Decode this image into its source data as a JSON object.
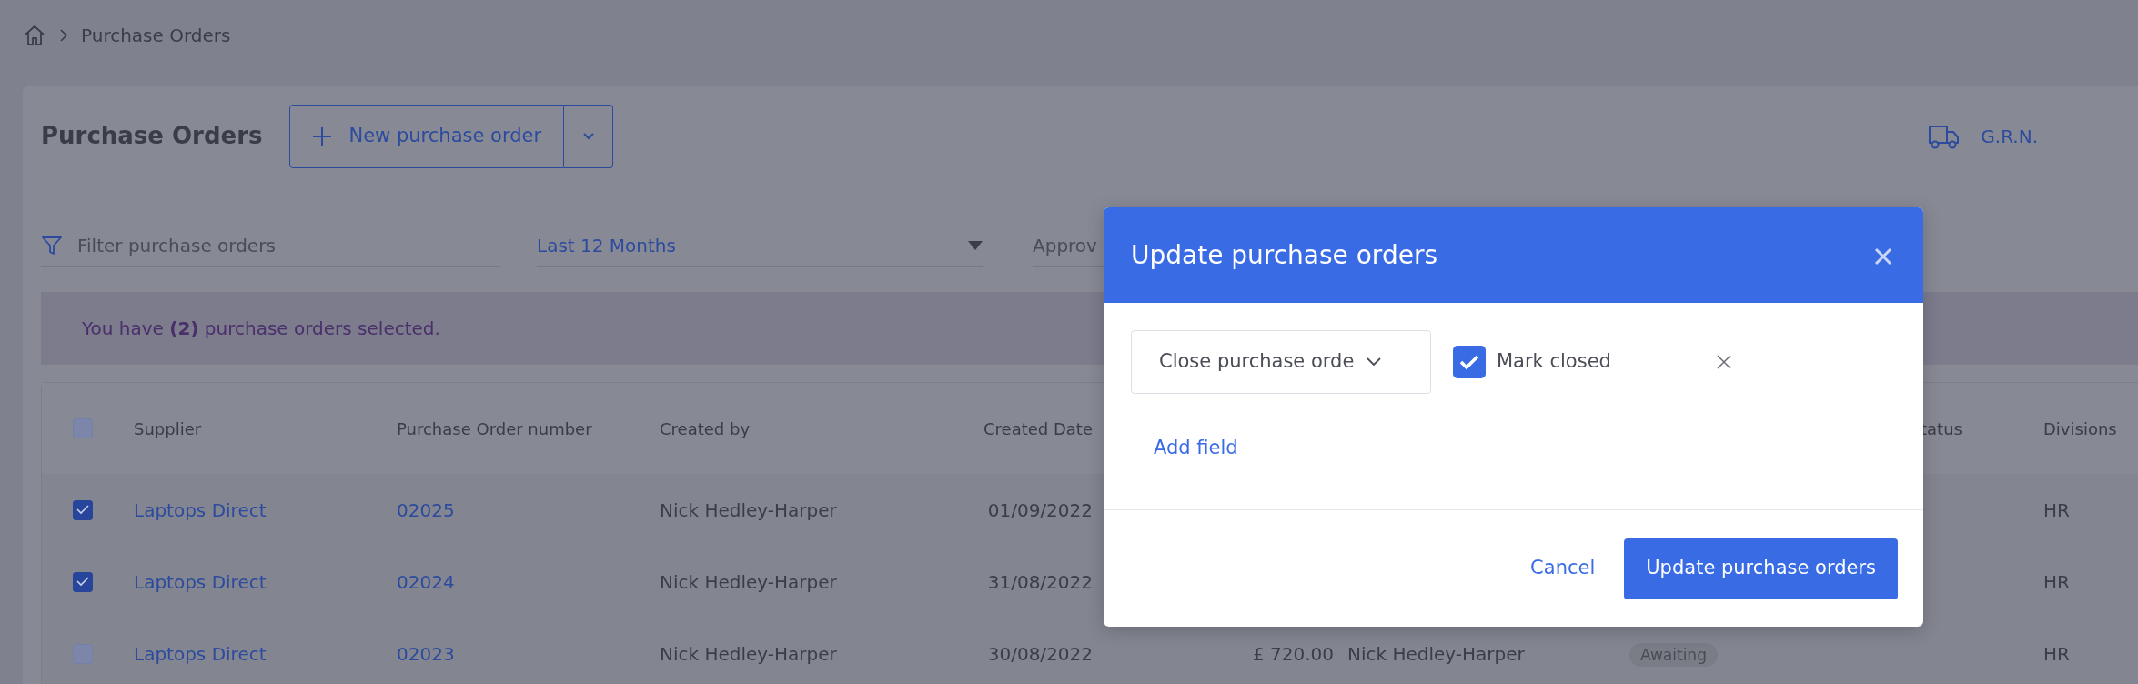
{
  "breadcrumb": {
    "current": "Purchase Orders"
  },
  "header": {
    "title": "Purchase Orders",
    "new_button": "New purchase order",
    "grn_link": "G.R.N."
  },
  "filters": {
    "search_placeholder": "Filter purchase orders",
    "period": "Last 12 Months",
    "approver_label": "Approv"
  },
  "alert": "You have **(2)** purchase orders selected.",
  "table": {
    "select_all_checked": false,
    "columns": [
      "Supplier",
      "Purchase Order number",
      "Created by",
      "Created Date",
      "tatus",
      "Divisions"
    ],
    "rows": [
      {
        "checked": true,
        "supplier": "Laptops Direct",
        "po_number": "02025",
        "created_by": "Nick Hedley-Harper",
        "created_date": "01/09/2022",
        "division": "HR"
      },
      {
        "checked": true,
        "supplier": "Laptops Direct",
        "po_number": "02024",
        "created_by": "Nick Hedley-Harper",
        "created_date": "31/08/2022",
        "division": "HR"
      },
      {
        "checked": false,
        "supplier": "Laptops Direct",
        "po_number": "02023",
        "created_by": "Nick Hedley-Harper",
        "created_date": "30/08/2022",
        "total": "£ 720.00",
        "approver": "Nick Hedley-Harper",
        "approval": "Awaiting",
        "division": "HR"
      }
    ]
  },
  "modal": {
    "title": "Update purchase orders",
    "field_select": "Close purchase orde",
    "checkbox": {
      "label": "Mark closed",
      "checked": true
    },
    "add_field": "Add field",
    "cancel": "Cancel",
    "submit": "Update purchase orders"
  }
}
